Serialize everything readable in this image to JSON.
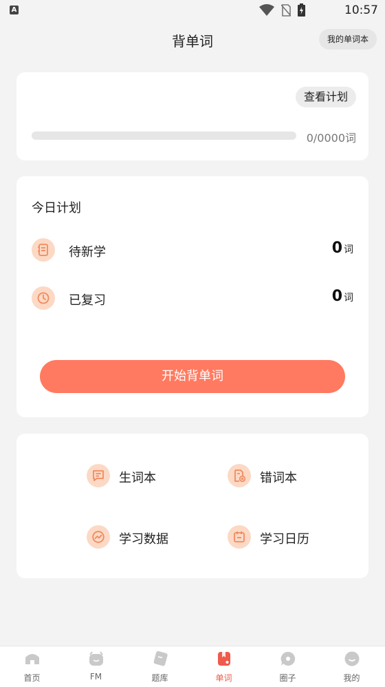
{
  "status_bar": {
    "time": "10:57",
    "app_badge": "A"
  },
  "header": {
    "title": "背单词",
    "wordbook_button": "我的单词本"
  },
  "progress_card": {
    "plan_button": "查看计划",
    "progress_text": "0/0000词",
    "progress_fraction": 0
  },
  "today_plan": {
    "title": "今日计划",
    "rows": [
      {
        "label": "待新学",
        "value": "0",
        "unit": "词",
        "icon": "notebook-icon"
      },
      {
        "label": "已复习",
        "value": "0",
        "unit": "词",
        "icon": "clock-icon"
      }
    ],
    "start_button": "开始背单词"
  },
  "tools": [
    {
      "label": "生词本",
      "icon": "message-list-icon"
    },
    {
      "label": "错词本",
      "icon": "wrong-word-doc-icon"
    },
    {
      "label": "学习数据",
      "icon": "trend-chart-icon"
    },
    {
      "label": "学习日历",
      "icon": "calendar-icon"
    }
  ],
  "tabbar": {
    "tabs": [
      {
        "label": "首页",
        "icon": "home-icon"
      },
      {
        "label": "FM",
        "icon": "fm-radio-icon"
      },
      {
        "label": "题库",
        "icon": "question-bank-icon"
      },
      {
        "label": "单词",
        "icon": "word-book-icon"
      },
      {
        "label": "圈子",
        "icon": "chat-bubble-icon"
      },
      {
        "label": "我的",
        "icon": "profile-icon"
      }
    ],
    "active_index": 3
  },
  "colors": {
    "accent": "#ff7a60",
    "icon_bg": "#fcd9c5",
    "icon_fg": "#f08a5d",
    "tab_active": "#f05a4a"
  }
}
